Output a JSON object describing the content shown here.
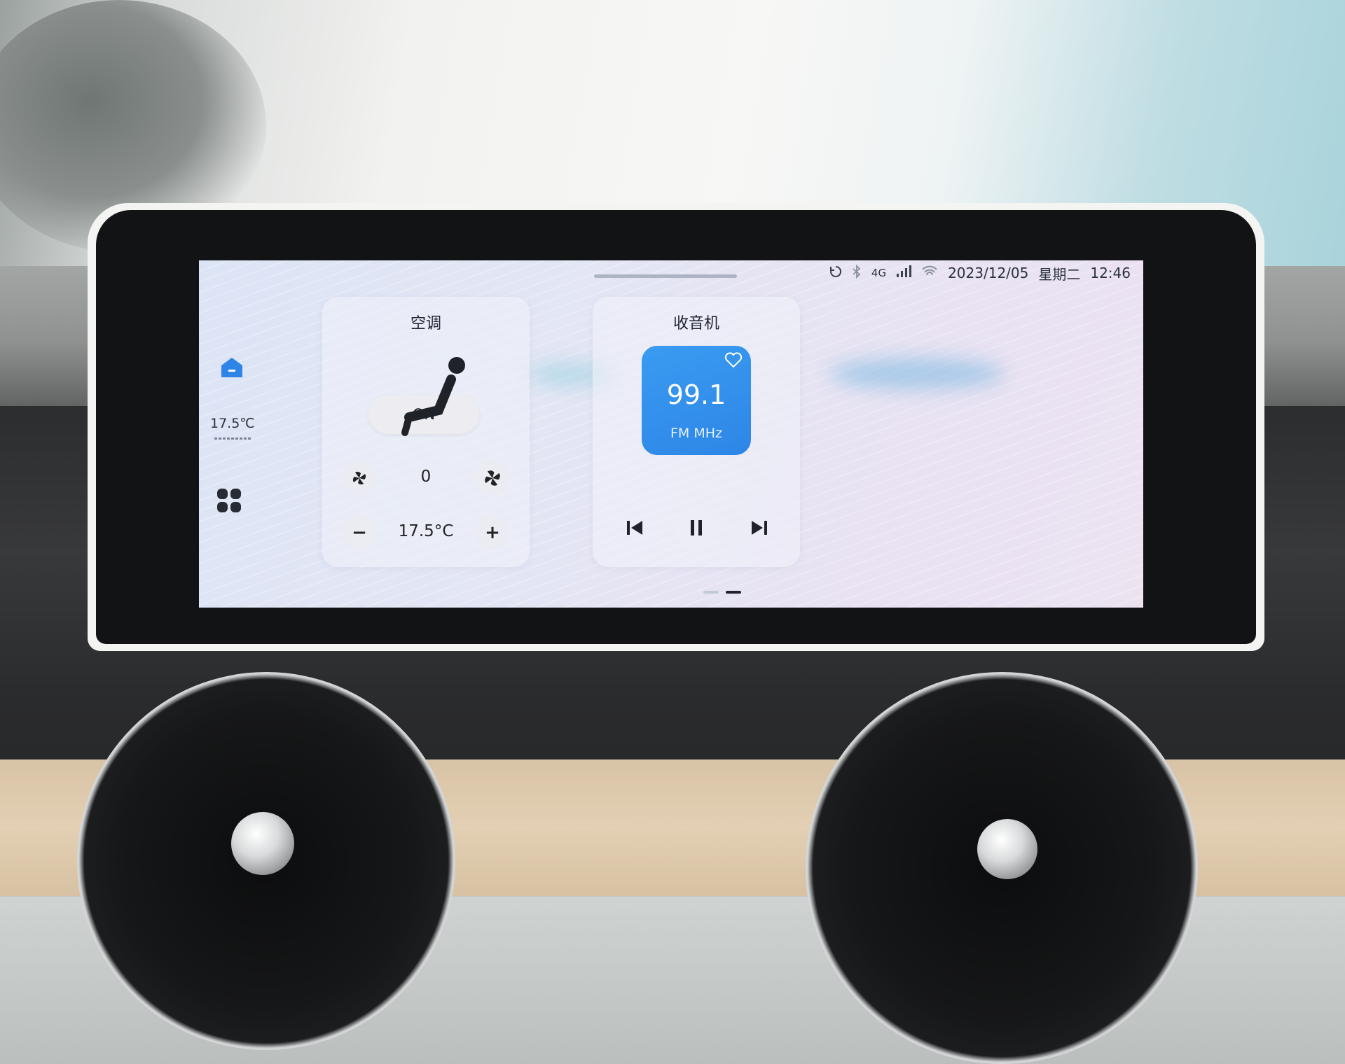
{
  "status_bar": {
    "network": "4G",
    "date": "2023/12/05",
    "weekday": "星期二",
    "time": "12:46"
  },
  "dock": {
    "temperature": "17.5℃"
  },
  "climate_card": {
    "title": "空调",
    "seat_state": "ON",
    "fan_speed": "0",
    "temperature": "17.5°C",
    "decrease_symbol": "−",
    "increase_symbol": "+"
  },
  "radio_card": {
    "title": "收音机",
    "frequency": "99.1",
    "band_unit": "FM MHz"
  },
  "pager": {
    "pages": 2,
    "active_page": 2
  },
  "colors": {
    "radio_tile": "#2d86e6",
    "home_icon": "#2f84e8",
    "text": "#1f2330"
  },
  "icons": [
    "home-icon",
    "apps-grid-icon",
    "fan-icon",
    "seat-icon",
    "heart-icon",
    "previous-icon",
    "pause-icon",
    "next-icon",
    "bluetooth-icon",
    "wifi-icon",
    "signal-icon",
    "sync-icon"
  ]
}
